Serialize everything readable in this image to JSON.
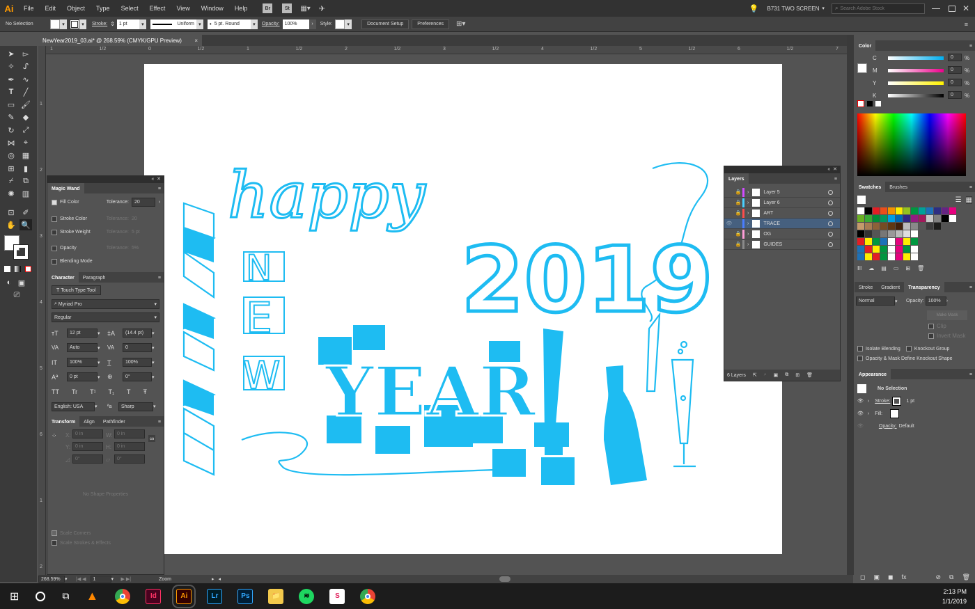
{
  "app": {
    "logo": "Ai",
    "menus": [
      "File",
      "Edit",
      "Object",
      "Type",
      "Select",
      "Effect",
      "View",
      "Window",
      "Help"
    ],
    "bridge": "Br",
    "stock": "St",
    "workspace": "B731 TWO SCREEN",
    "search_placeholder": "Search Adobe Stock"
  },
  "control": {
    "selection": "No Selection",
    "stroke_label": "Stroke:",
    "stroke_value": "1 pt",
    "profile": "Uniform",
    "brush": "5 pt. Round",
    "opacity_label": "Opacity:",
    "opacity_value": "100%",
    "style_label": "Style:",
    "doc_setup": "Document Setup",
    "preferences": "Preferences"
  },
  "document": {
    "tab_title": "NewYear2019_03.ai* @ 268.59% (CMYK/GPU Preview)",
    "close": "×"
  },
  "ruler": {
    "h": [
      "1",
      "1/2",
      "0",
      "1/2",
      "1",
      "1/2",
      "2",
      "1/2",
      "3",
      "1/2",
      "4",
      "1/2",
      "5",
      "1/2",
      "6",
      "1/2",
      "7"
    ],
    "v": [
      "1",
      "2",
      "3",
      "4",
      "5",
      "6",
      "1",
      "2"
    ]
  },
  "magic_wand": {
    "title": "Magic Wand",
    "fill_color": "Fill Color",
    "tolerance_label": "Tolerance:",
    "tolerance_value": "20",
    "stroke_color": "Stroke Color",
    "stroke_weight": "Stroke Weight",
    "opacity": "Opacity",
    "blending": "Blending Mode",
    "dim_tol1": "20",
    "dim_tol2": "5 pt",
    "dim_tol3": "5%"
  },
  "character": {
    "tabs": [
      "Character",
      "Paragraph"
    ],
    "touch": "Touch Type Tool",
    "font": "Myriad Pro",
    "style": "Regular",
    "size": "12 pt",
    "leading": "(14.4 pt)",
    "kern": "Auto",
    "track": "0",
    "vscale": "100%",
    "hscale": "100%",
    "baseline": "0 pt",
    "rotate": "0°",
    "caps": [
      "TT",
      "Tr",
      "T¹",
      "T₁",
      "T",
      "Ŧ"
    ],
    "language": "English: USA",
    "aa": "Sharp",
    "aa_label": "ªa"
  },
  "transform": {
    "tabs": [
      "Transform",
      "Align",
      "Pathfinder"
    ],
    "x": "0 in",
    "y": "0 in",
    "w": "0 in",
    "h": "0 in",
    "angle": "0°",
    "shear": "0°",
    "no_shape": "No Shape Properties",
    "scale_corners": "Scale Corners",
    "scale_strokes": "Scale Strokes & Effects",
    "labels": {
      "x": "X:",
      "y": "Y:",
      "w": "W:",
      "h": "H:"
    }
  },
  "layers": {
    "title": "Layers",
    "rows": [
      {
        "name": "Layer 5",
        "color": "#d14cff",
        "locked": true,
        "visible": false,
        "selected": false
      },
      {
        "name": "Layer 6",
        "color": "#4ad0ff",
        "locked": true,
        "visible": false,
        "selected": false
      },
      {
        "name": "ART",
        "color": "#ff4d4d",
        "locked": true,
        "visible": false,
        "selected": false
      },
      {
        "name": "TRACE",
        "color": "#4a7dff",
        "locked": false,
        "visible": true,
        "selected": true
      },
      {
        "name": "OG",
        "color": "#ff9dd8",
        "locked": true,
        "visible": false,
        "selected": false
      },
      {
        "name": "GUIDES",
        "color": "#8a8a8a",
        "locked": true,
        "visible": false,
        "selected": false
      }
    ],
    "count": "6 Layers"
  },
  "color": {
    "title": "Color",
    "channels": [
      {
        "label": "C",
        "value": "0"
      },
      {
        "label": "M",
        "value": "0"
      },
      {
        "label": "Y",
        "value": "0"
      },
      {
        "label": "K",
        "value": "0"
      }
    ],
    "pct": "%"
  },
  "swatches": {
    "tabs": [
      "Swatches",
      "Brushes"
    ]
  },
  "transparency": {
    "tabs": [
      "Stroke",
      "Gradient",
      "Transparency"
    ],
    "mode": "Normal",
    "opacity_label": "Opacity:",
    "opacity": "100%",
    "make_mask": "Make Mask",
    "clip": "Clip",
    "invert": "Invert Mask",
    "isolate": "Isolate Blending",
    "knockout": "Knockout Group",
    "opacity_mask": "Opacity & Mask Define Knockout Shape"
  },
  "appearance": {
    "title": "Appearance",
    "selection": "No Selection",
    "stroke_label": "Stroke:",
    "stroke_value": "1 pt",
    "fill_label": "Fill:",
    "opacity_label": "Opacity:",
    "opacity_value": "Default"
  },
  "status": {
    "zoom": "268.59%",
    "artboard": "1",
    "tool": "Zoom"
  },
  "taskbar": {
    "time": "2:13 PM",
    "date": "1/1/2019",
    "apps": [
      {
        "label": "Id",
        "color": "#49021f",
        "fg": "#ff3366"
      },
      {
        "label": "Ai",
        "color": "#330000",
        "fg": "#ff9a00"
      },
      {
        "label": "Lr",
        "color": "#001d26",
        "fg": "#31a8ff"
      },
      {
        "label": "Ps",
        "color": "#001e36",
        "fg": "#31a8ff"
      }
    ]
  },
  "artwork": {
    "color": "#1ebcf2",
    "happy": "happy",
    "year": "2019",
    "n": "N",
    "e": "E",
    "w": "W",
    "yr": "YEAR",
    "bang": "!"
  }
}
